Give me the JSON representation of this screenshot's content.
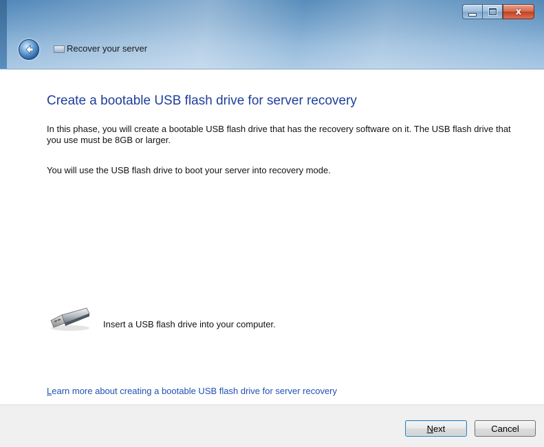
{
  "window": {
    "nav_title": "Recover your server",
    "caption_buttons": {
      "minimize_icon": "minimize-icon",
      "maximize_icon": "maximize-icon",
      "close_icon": "close-icon",
      "close_glyph": "x"
    },
    "back_icon": "back-arrow-icon"
  },
  "main": {
    "title": "Create a bootable USB flash drive for server recovery",
    "paragraph1": "In this phase, you will create a bootable USB flash drive that has the recovery software on it. The USB flash drive that you use must be 8GB or larger.",
    "paragraph2": "You will use the USB flash drive to boot your server into recovery mode.",
    "usb_status": {
      "icon": "usb-flash-drive-icon",
      "text": "Insert a USB flash drive into your computer."
    },
    "learn_more": {
      "mnemonic": "L",
      "rest": "earn more about creating a bootable USB flash drive for server recovery"
    }
  },
  "footer": {
    "next": {
      "mnemonic": "N",
      "rest": "ext"
    },
    "cancel": "Cancel"
  },
  "colors": {
    "title": "#1e3e9a",
    "link": "#1f4fb4",
    "footer_bg": "#f0f0f0"
  }
}
